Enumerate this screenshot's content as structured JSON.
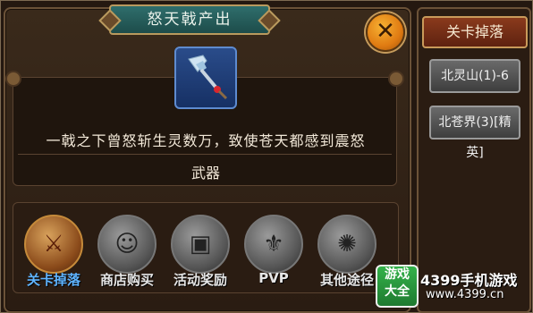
{
  "dialog": {
    "title": "怒天戟产出",
    "close_label": "✕",
    "item_description": "一戟之下曾怒斩生灵数万，致使苍天都感到震怒",
    "item_type": "武器"
  },
  "sources": [
    {
      "label": "关卡掉落",
      "icon": "crossed-swords-icon",
      "active": true
    },
    {
      "label": "商店购买",
      "icon": "merchant-icon",
      "active": false
    },
    {
      "label": "活动奖励",
      "icon": "treasure-chest-icon",
      "active": false
    },
    {
      "label": "PVP",
      "icon": "pvp-mask-icon",
      "active": false
    },
    {
      "label": "其他途径",
      "icon": "swirl-icon",
      "active": false
    }
  ],
  "side_panel": {
    "tab_label": "关卡掉落",
    "stages": [
      "北灵山(1)-6",
      "北苍界(3)[精英]"
    ]
  },
  "watermark": {
    "badge_line1": "游戏",
    "badge_line2": "大全",
    "brand": "4399手机游戏",
    "url": "www.4399.cn"
  },
  "colors": {
    "accent_orange": "#e07b12",
    "title_teal": "#2f6e6c",
    "active_blue": "#5fb4ff"
  }
}
